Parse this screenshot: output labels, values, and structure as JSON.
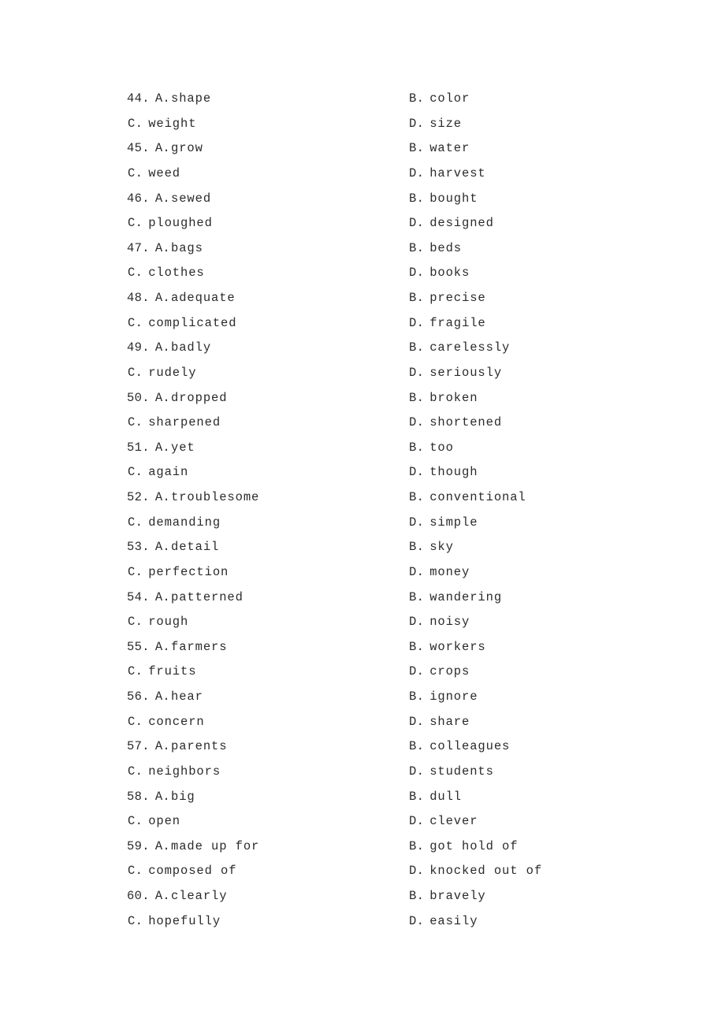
{
  "document": {
    "type": "multiple-choice-answer-options",
    "page_background": "#ffffff",
    "text_color": "#2b2b2b",
    "first_question_number": 44,
    "last_question_number": 60
  },
  "questions": [
    {
      "number": "44.",
      "a_label": "A.",
      "a_text": "shape",
      "b_label": "B.",
      "b_text": "color",
      "c_label": "C.",
      "c_text": "weight",
      "d_label": "D.",
      "d_text": "size"
    },
    {
      "number": "45.",
      "a_label": "A.",
      "a_text": "grow",
      "b_label": "B.",
      "b_text": "water",
      "c_label": "C.",
      "c_text": "weed",
      "d_label": "D.",
      "d_text": "harvest"
    },
    {
      "number": "46.",
      "a_label": "A.",
      "a_text": "sewed",
      "b_label": "B.",
      "b_text": "bought",
      "c_label": "C.",
      "c_text": "ploughed",
      "d_label": "D.",
      "d_text": "designed"
    },
    {
      "number": "47.",
      "a_label": "A.",
      "a_text": "bags",
      "b_label": "B.",
      "b_text": "beds",
      "c_label": "C.",
      "c_text": "clothes",
      "d_label": "D.",
      "d_text": "books"
    },
    {
      "number": "48.",
      "a_label": "A.",
      "a_text": "adequate",
      "b_label": "B.",
      "b_text": "precise",
      "c_label": "C.",
      "c_text": "complicated",
      "d_label": "D.",
      "d_text": "fragile"
    },
    {
      "number": "49.",
      "a_label": "A.",
      "a_text": "badly",
      "b_label": "B.",
      "b_text": "carelessly",
      "c_label": "C.",
      "c_text": "rudely",
      "d_label": "D.",
      "d_text": "seriously"
    },
    {
      "number": "50.",
      "a_label": "A.",
      "a_text": "dropped",
      "b_label": "B.",
      "b_text": "broken",
      "c_label": "C.",
      "c_text": "sharpened",
      "d_label": "D.",
      "d_text": "shortened"
    },
    {
      "number": "51.",
      "a_label": "A.",
      "a_text": "yet",
      "b_label": "B.",
      "b_text": "too",
      "c_label": "C.",
      "c_text": "again",
      "d_label": "D.",
      "d_text": "though"
    },
    {
      "number": "52.",
      "a_label": "A.",
      "a_text": "troublesome",
      "b_label": "B.",
      "b_text": "conventional",
      "c_label": "C.",
      "c_text": "demanding",
      "d_label": "D.",
      "d_text": "simple"
    },
    {
      "number": "53.",
      "a_label": "A.",
      "a_text": "detail",
      "b_label": "B.",
      "b_text": "sky",
      "c_label": "C.",
      "c_text": "perfection",
      "d_label": "D.",
      "d_text": "money"
    },
    {
      "number": "54.",
      "a_label": "A.",
      "a_text": "patterned",
      "b_label": "B.",
      "b_text": "wandering",
      "c_label": "C.",
      "c_text": "rough",
      "d_label": "D.",
      "d_text": "noisy"
    },
    {
      "number": "55.",
      "a_label": "A.",
      "a_text": "farmers",
      "b_label": "B.",
      "b_text": "workers",
      "c_label": "C.",
      "c_text": "fruits",
      "d_label": "D.",
      "d_text": "crops"
    },
    {
      "number": "56.",
      "a_label": "A.",
      "a_text": "hear",
      "b_label": "B.",
      "b_text": "ignore",
      "c_label": "C.",
      "c_text": "concern",
      "d_label": "D.",
      "d_text": "share"
    },
    {
      "number": "57.",
      "a_label": "A.",
      "a_text": "parents",
      "b_label": "B.",
      "b_text": "colleagues",
      "c_label": "C.",
      "c_text": "neighbors",
      "d_label": "D.",
      "d_text": "students"
    },
    {
      "number": "58.",
      "a_label": "A.",
      "a_text": "big",
      "b_label": "B.",
      "b_text": "dull",
      "c_label": "C.",
      "c_text": "open",
      "d_label": "D.",
      "d_text": "clever"
    },
    {
      "number": "59.",
      "a_label": "A.",
      "a_text": "made up for",
      "b_label": "B.",
      "b_text": "got hold of",
      "c_label": "C.",
      "c_text": "composed of",
      "d_label": "D.",
      "d_text": "knocked out of"
    },
    {
      "number": "60.",
      "a_label": "A.",
      "a_text": "clearly",
      "b_label": "B.",
      "b_text": "bravely",
      "c_label": "C.",
      "c_text": "hopefully",
      "d_label": "D.",
      "d_text": "easily"
    }
  ]
}
